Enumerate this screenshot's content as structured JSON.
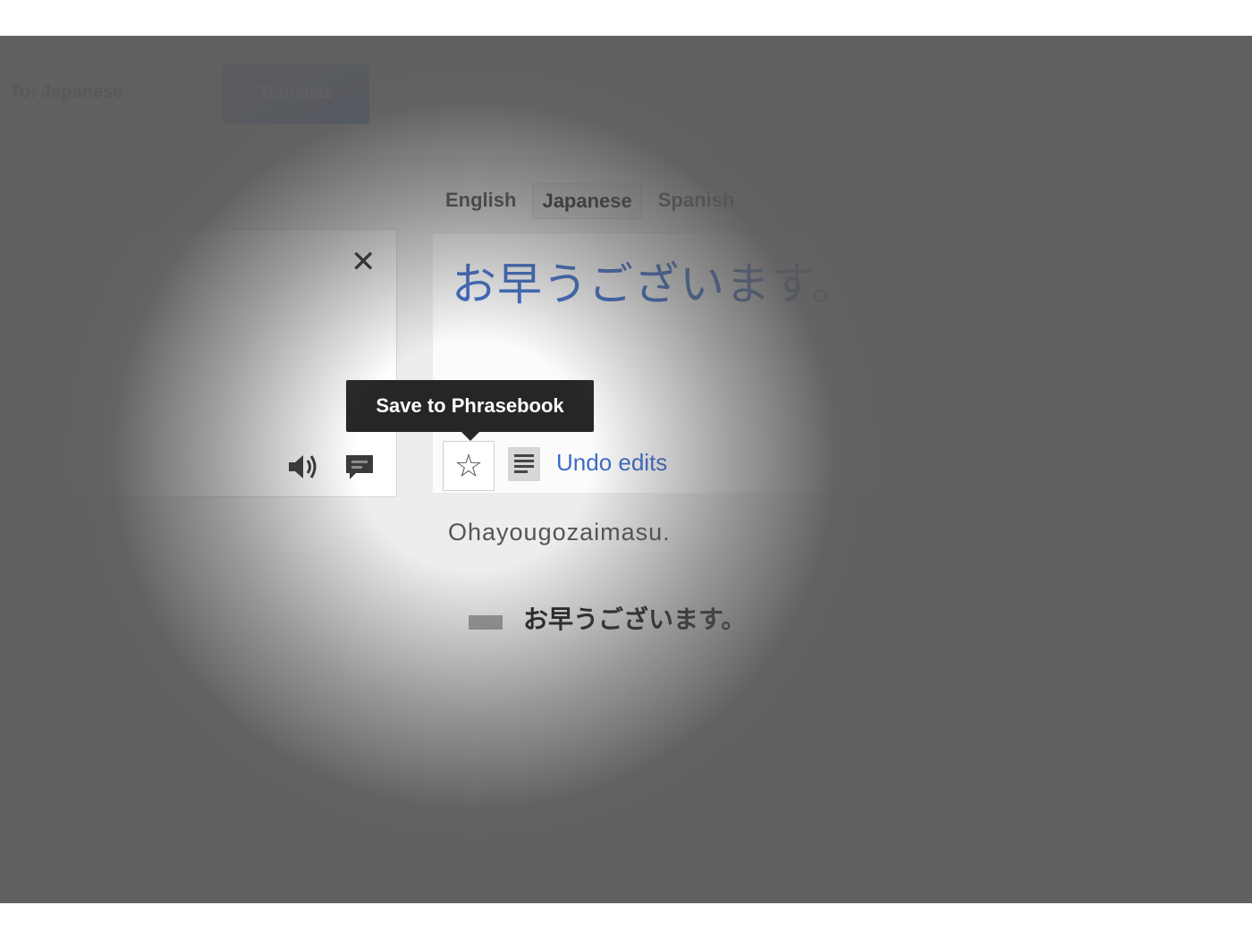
{
  "toolbar": {
    "target_language_label": "To: Japanese",
    "caret": "⌄",
    "translate_label": "Translate",
    "translate_color": "#3f72d8"
  },
  "result_tabs": [
    {
      "label": "English",
      "active": false
    },
    {
      "label": "Japanese",
      "active": true
    },
    {
      "label": "Spanish",
      "active": false
    }
  ],
  "source_panel": {
    "clear_icon": "close-icon",
    "clear_glyph": "✕",
    "listen_icon": "speaker-icon",
    "feedback_icon": "speech-bubble-icon"
  },
  "result": {
    "translation": "お早うございます。",
    "translation_color": "#3c6cc8",
    "tooltip": "Save to Phrasebook",
    "star_icon": "star-outline-icon",
    "star_glyph": "☆",
    "list_icon": "text-list-icon",
    "undo_label": "Undo edits",
    "romanization": "Ohayougozaimasu.",
    "alternate_translation": "お早うございます。"
  }
}
